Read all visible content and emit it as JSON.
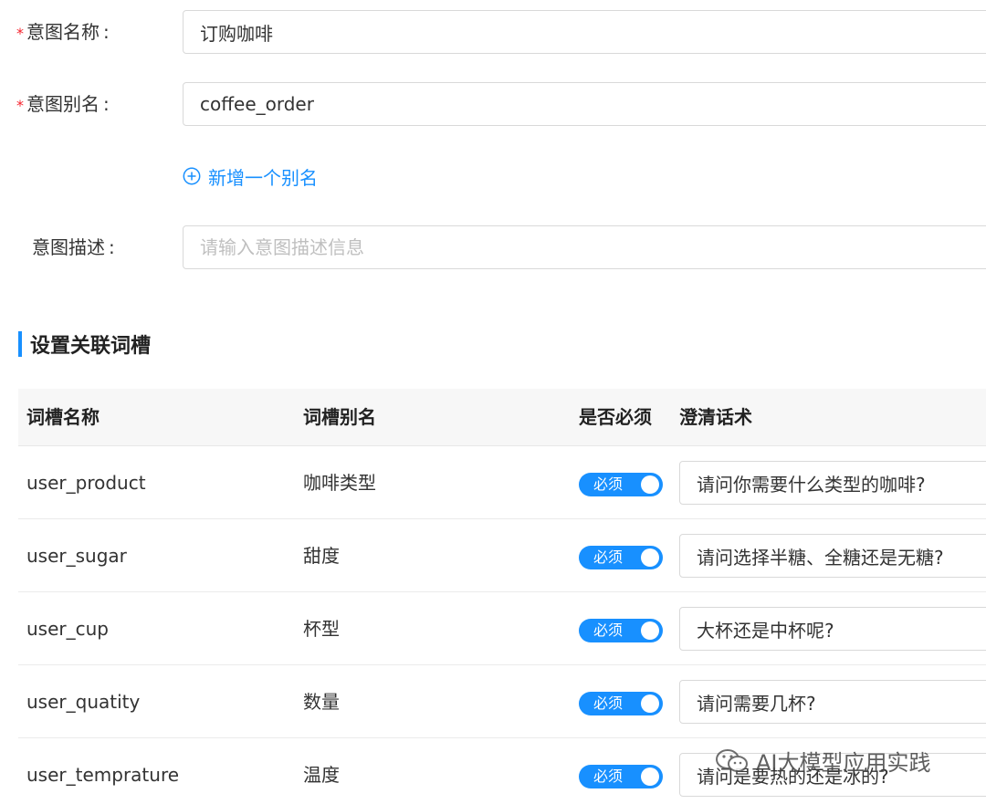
{
  "form": {
    "intent_name": {
      "label": "意图名称",
      "required": true,
      "value": "订购咖啡"
    },
    "intent_alias": {
      "label": "意图别名",
      "required": true,
      "value": "coffee_order"
    },
    "add_alias_label": "新增一个别名",
    "intent_desc": {
      "label": "意图描述",
      "placeholder": "请输入意图描述信息",
      "value": ""
    },
    "colon": ":",
    "required_mark": "*"
  },
  "section": {
    "title": "设置关联词槽"
  },
  "table": {
    "headers": [
      "词槽名称",
      "词槽别名",
      "是否必须",
      "澄清话术"
    ],
    "rows": [
      {
        "name": "user_product",
        "alias": "咖啡类型",
        "required_label": "必须",
        "required": true,
        "clarify": "请问你需要什么类型的咖啡?"
      },
      {
        "name": "user_sugar",
        "alias": "甜度",
        "required_label": "必须",
        "required": true,
        "clarify": "请问选择半糖、全糖还是无糖?"
      },
      {
        "name": "user_cup",
        "alias": "杯型",
        "required_label": "必须",
        "required": true,
        "clarify": "大杯还是中杯呢?"
      },
      {
        "name": "user_quatity",
        "alias": "数量",
        "required_label": "必须",
        "required": true,
        "clarify": "请问需要几杯?"
      },
      {
        "name": "user_temprature",
        "alias": "温度",
        "required_label": "必须",
        "required": true,
        "clarify": "请问是要热的还是冰的?"
      }
    ]
  },
  "watermark": {
    "text": "AI大模型应用实践",
    "icon": "wechat-icon"
  },
  "colors": {
    "accent": "#1890ff",
    "required_star": "#f5222d",
    "header_bg": "#f7f7f7"
  }
}
